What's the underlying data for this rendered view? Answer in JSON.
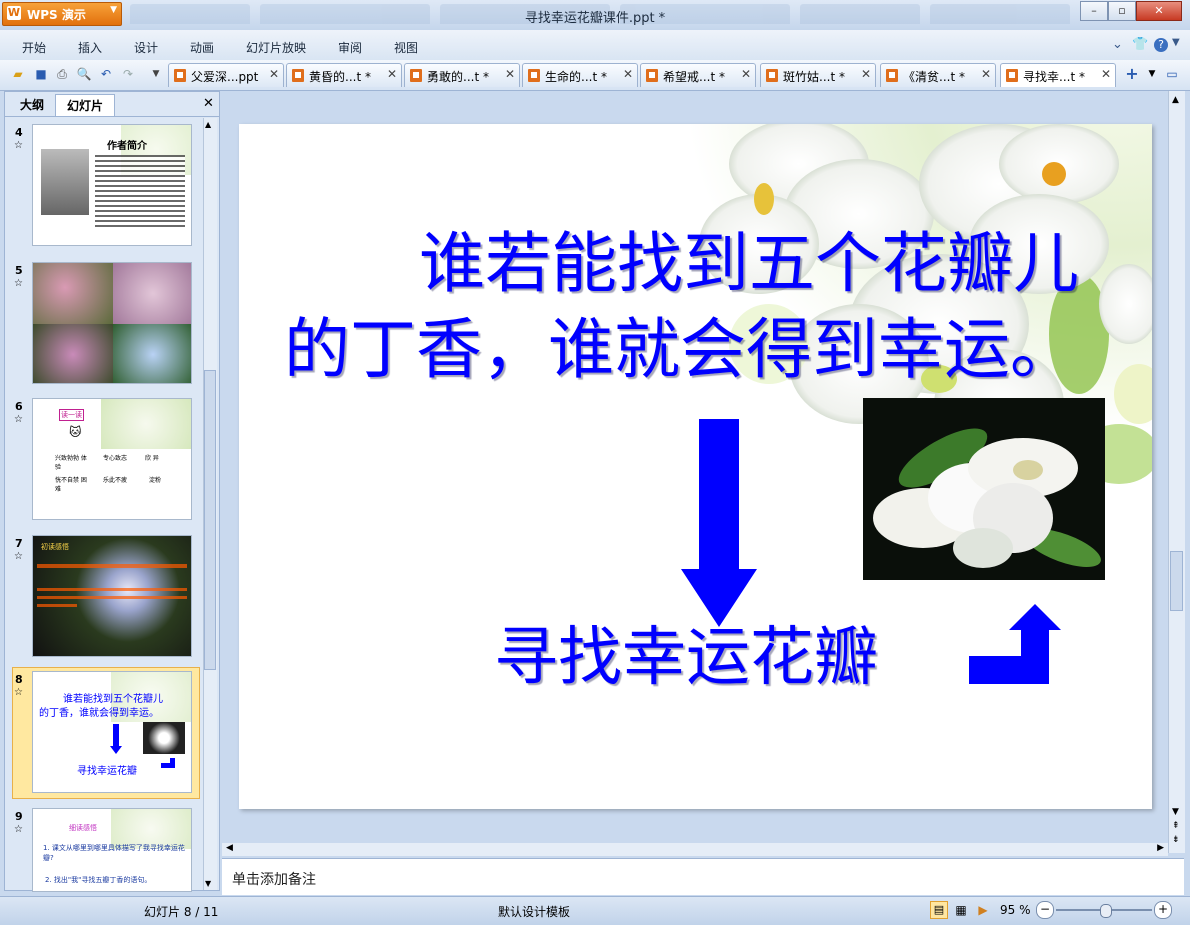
{
  "app": {
    "name": "WPS 演示",
    "window_title": "寻找幸运花瓣课件.ppt *"
  },
  "colors": {
    "accent": "#e2700c",
    "slide_text": "#0000ff",
    "selection": "#ffe8a0"
  },
  "menu": [
    "开始",
    "插入",
    "设计",
    "动画",
    "幻灯片放映",
    "审阅",
    "视图"
  ],
  "toolbar_icons": [
    "open-icon",
    "save-icon",
    "print-icon",
    "print-preview-icon",
    "undo-icon",
    "redo-icon",
    "customize-icon"
  ],
  "doc_tabs": [
    {
      "label": "父爱深...ppt",
      "active": false
    },
    {
      "label": "黄昏的...t *",
      "active": false
    },
    {
      "label": "勇敢的...t *",
      "active": false
    },
    {
      "label": "生命的...t *",
      "active": false
    },
    {
      "label": "希望戒...t *",
      "active": false
    },
    {
      "label": "斑竹姑...t *",
      "active": false
    },
    {
      "label": "《清贫...t *",
      "active": false
    },
    {
      "label": "寻找幸...t *",
      "active": true
    }
  ],
  "left_panel": {
    "tabs": [
      "大纲",
      "幻灯片"
    ],
    "active_tab": "幻灯片",
    "slides": [
      {
        "num": "4",
        "title": "作者简介"
      },
      {
        "num": "5"
      },
      {
        "num": "6",
        "lines": [
          "读一读",
          "兴致勃勃 体验",
          "专心致志",
          "欣 异",
          "恍不自禁 困难",
          "乐此不疲",
          "淀粉"
        ]
      },
      {
        "num": "7",
        "lines": [
          "初读感悟"
        ]
      },
      {
        "num": "8",
        "selected": true,
        "lines": [
          "谁若能找到五个花瓣儿",
          "的丁香，谁就会得到幸运。",
          "寻找幸运花瓣"
        ]
      },
      {
        "num": "9",
        "lines": [
          "细读感悟",
          "1. 课文从哪里到哪里具体描写了我寻找幸运花瓣?",
          "2. 找出\"我\"寻找五瓣丁香的语句。"
        ]
      }
    ]
  },
  "slide": {
    "line1": "谁若能找到五个花瓣儿",
    "line2": "的丁香，谁就会得到幸运。",
    "caption": "寻找幸运花瓣"
  },
  "notes_placeholder": "单击添加备注",
  "status": {
    "slide_counter": "幻灯片 8 / 11",
    "template": "默认设计模板",
    "zoom": "95 %",
    "zoom_level": 0.52
  }
}
